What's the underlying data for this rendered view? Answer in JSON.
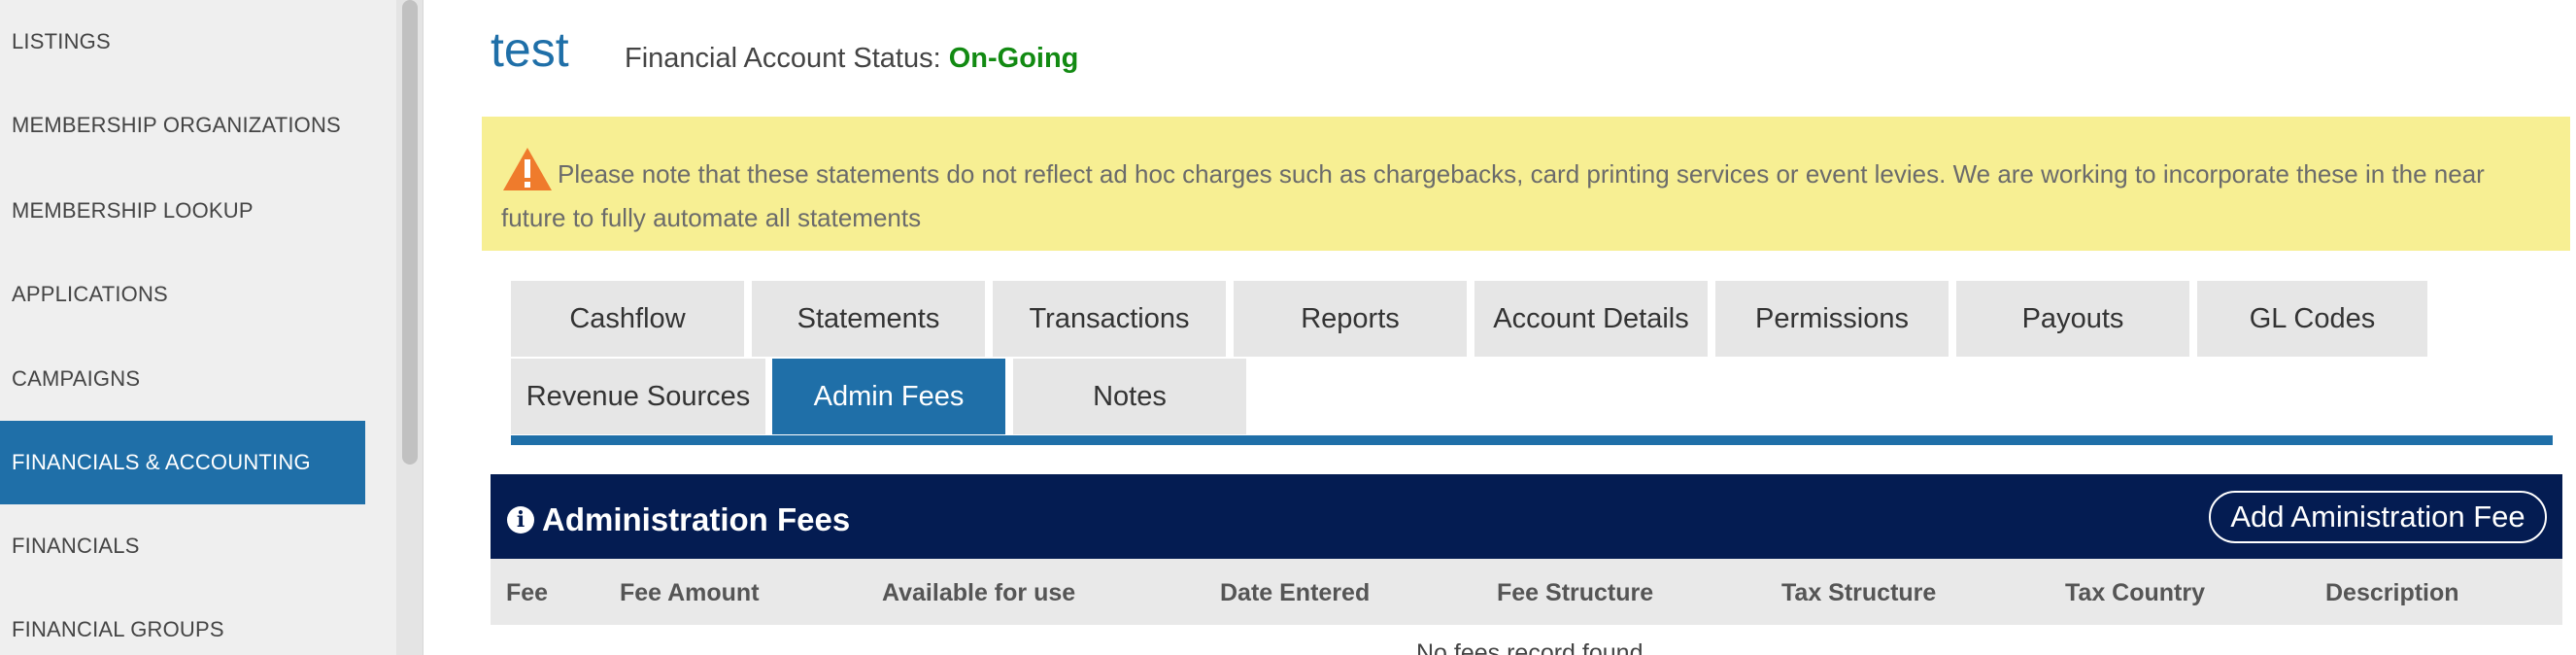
{
  "sidebar": {
    "items": [
      {
        "label": "LISTINGS",
        "active": false
      },
      {
        "label": "MEMBERSHIP ORGANIZATIONS",
        "active": false
      },
      {
        "label": "MEMBERSHIP LOOKUP",
        "active": false
      },
      {
        "label": "APPLICATIONS",
        "active": false
      },
      {
        "label": "CAMPAIGNS",
        "active": false
      },
      {
        "label": "FINANCIALS & ACCOUNTING",
        "active": true
      },
      {
        "label": "FINANCIALS",
        "active": false
      },
      {
        "label": "FINANCIAL GROUPS",
        "active": false
      }
    ],
    "active_color": "#1f6fa8"
  },
  "header": {
    "title": "test",
    "status_label": "Financial Account Status:",
    "status_value": "On-Going",
    "status_color": "#128a12"
  },
  "notice": {
    "icon": "warning-icon",
    "text": "Please note that these statements do not reflect ad hoc charges such as chargebacks, card printing services or event levies. We are working to incorporate these in the near future to fully automate all statements",
    "background": "#f7ef93"
  },
  "tabs": [
    {
      "label": "Cashflow",
      "active": false
    },
    {
      "label": "Statements",
      "active": false
    },
    {
      "label": "Transactions",
      "active": false
    },
    {
      "label": "Reports",
      "active": false
    },
    {
      "label": "Account Details",
      "active": false
    },
    {
      "label": "Permissions",
      "active": false
    },
    {
      "label": "Payouts",
      "active": false
    },
    {
      "label": "GL Codes",
      "active": false
    },
    {
      "label": "Revenue Sources",
      "active": false
    },
    {
      "label": "Admin Fees",
      "active": true
    },
    {
      "label": "Notes",
      "active": false
    }
  ],
  "panel": {
    "info_icon": "i",
    "title": "Administration Fees",
    "add_button_label": "Add Aministration Fee",
    "header_color": "#041c52",
    "columns": [
      "Fee",
      "Fee Amount",
      "Available for use",
      "Date Entered",
      "Fee Structure",
      "Tax Structure",
      "Tax Country",
      "Description"
    ],
    "empty_message": "No fees record found"
  }
}
